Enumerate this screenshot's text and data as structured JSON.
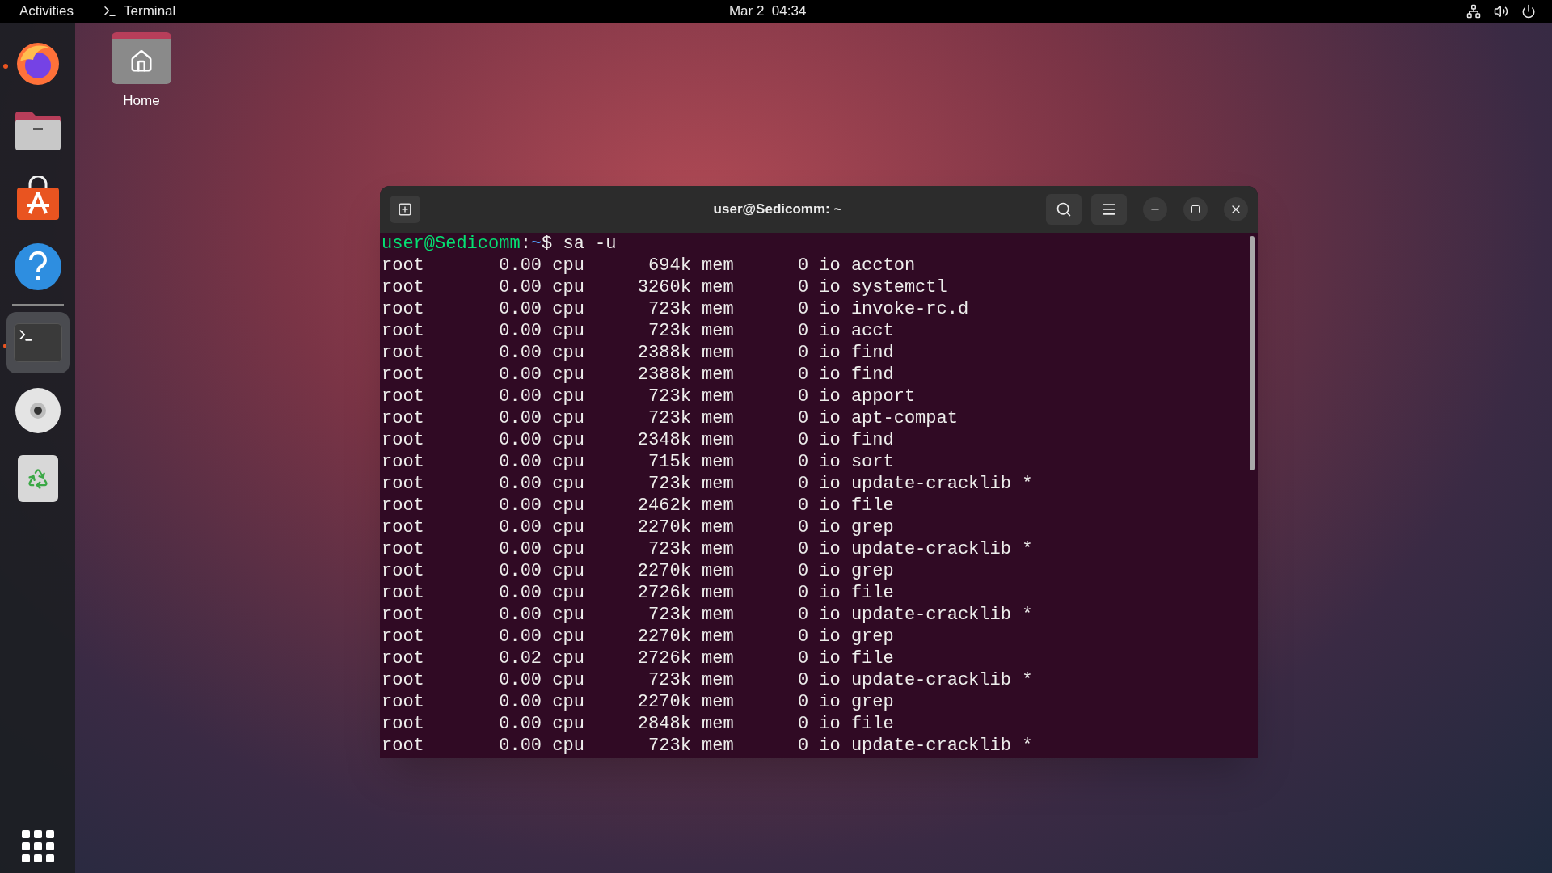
{
  "top_bar": {
    "activities": "Activities",
    "app_menu": "Terminal",
    "clock": "Mar 2  04:34"
  },
  "dock": {
    "items": [
      {
        "kind": "browser",
        "running": true,
        "selected": false
      },
      {
        "kind": "files",
        "running": false,
        "selected": false
      },
      {
        "kind": "software",
        "running": false,
        "selected": false
      },
      {
        "kind": "help",
        "running": false,
        "selected": false
      },
      {
        "kind": "terminal",
        "running": true,
        "selected": true
      },
      {
        "kind": "disc",
        "running": false,
        "selected": false
      },
      {
        "kind": "trash",
        "running": false,
        "selected": false
      }
    ]
  },
  "desktop_icons": [
    {
      "label": "Home"
    }
  ],
  "terminal": {
    "title": "user@Sedicomm: ~",
    "prompt": {
      "user": "user@Sedicomm",
      "separator": ":",
      "path": "~",
      "symbol": "$",
      "command": "sa -u"
    },
    "lines": [
      "root       0.00 cpu      694k mem      0 io accton",
      "root       0.00 cpu     3260k mem      0 io systemctl",
      "root       0.00 cpu      723k mem      0 io invoke-rc.d",
      "root       0.00 cpu      723k mem      0 io acct",
      "root       0.00 cpu     2388k mem      0 io find",
      "root       0.00 cpu     2388k mem      0 io find",
      "root       0.00 cpu      723k mem      0 io apport",
      "root       0.00 cpu      723k mem      0 io apt-compat",
      "root       0.00 cpu     2348k mem      0 io find",
      "root       0.00 cpu      715k mem      0 io sort",
      "root       0.00 cpu      723k mem      0 io update-cracklib *",
      "root       0.00 cpu     2462k mem      0 io file",
      "root       0.00 cpu     2270k mem      0 io grep",
      "root       0.00 cpu      723k mem      0 io update-cracklib *",
      "root       0.00 cpu     2270k mem      0 io grep",
      "root       0.00 cpu     2726k mem      0 io file",
      "root       0.00 cpu      723k mem      0 io update-cracklib *",
      "root       0.00 cpu     2270k mem      0 io grep",
      "root       0.02 cpu     2726k mem      0 io file",
      "root       0.00 cpu      723k mem      0 io update-cracklib *",
      "root       0.00 cpu     2270k mem      0 io grep",
      "root       0.00 cpu     2848k mem      0 io file",
      "root       0.00 cpu      723k mem      0 io update-cracklib *"
    ]
  }
}
